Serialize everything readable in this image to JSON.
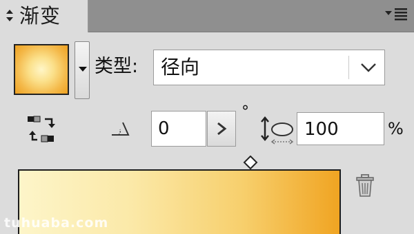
{
  "tab": {
    "title": "渐变"
  },
  "icons": {
    "tab_arrows": "up-down-arrows-icon",
    "panel_menu": "panel-menu-icon",
    "swatch_dropdown": "triangle-down-icon",
    "type_chevron": "chevron-down-icon",
    "reverse": "reverse-gradient-icon",
    "angle": "angle-icon",
    "angle_stepper": "chevron-right-icon",
    "aspect": "aspect-ratio-icon",
    "midpoint": "diamond-icon",
    "delete": "trash-icon"
  },
  "swatch": {
    "colors": [
      "#fff6c8",
      "#fbe08a",
      "#f4b94a",
      "#eda020"
    ]
  },
  "type": {
    "label": "类型:",
    "value": "径向"
  },
  "angle": {
    "value": "0",
    "unit": "°"
  },
  "aspect": {
    "value": "100",
    "unit": "%"
  },
  "gradient": {
    "colors": [
      "#fdf5c9",
      "#fbe9a8",
      "#f7cf6c",
      "#f0a422"
    ]
  },
  "watermark": "tuhuaba.com"
}
